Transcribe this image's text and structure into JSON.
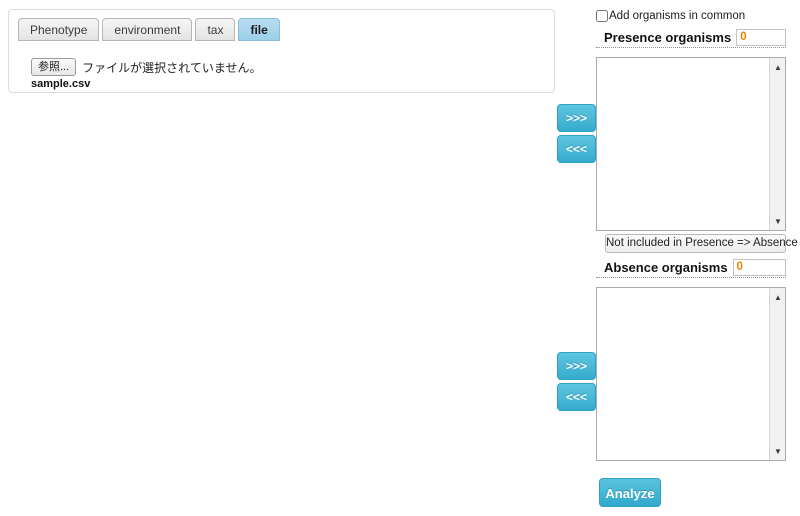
{
  "left_panel": {
    "tabs": [
      {
        "label": "Phenotype",
        "active": false
      },
      {
        "label": "environment",
        "active": false
      },
      {
        "label": "tax",
        "active": false
      },
      {
        "label": "file",
        "active": true
      }
    ],
    "file_upload": {
      "browse_label": "参照...",
      "status_text": "ファイルが選択されていません。",
      "selected_file": "sample.csv"
    }
  },
  "right_panel": {
    "common_checkbox": {
      "label": "Add organisms in common",
      "checked": false
    },
    "presence": {
      "title": "Presence organisms",
      "count": "0",
      "items": []
    },
    "absence": {
      "title": "Absence organisms",
      "count": "0",
      "items": []
    },
    "not_included_button": "Not included in Presence => Absence",
    "analyze_button": "Analyze"
  },
  "transfer_controls": {
    "add_label": ">>>",
    "remove_label": "<<<"
  },
  "scroll": {
    "up_glyph": "▲",
    "down_glyph": "▼"
  },
  "colors": {
    "accent": "#35abcd",
    "count_text": "#f08000",
    "active_tab": "#9ccfe9"
  }
}
